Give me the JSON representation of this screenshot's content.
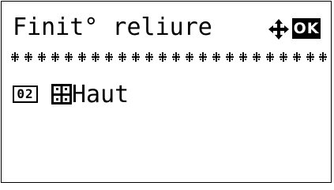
{
  "screen": {
    "title": "Finit° reliure",
    "nav_icon": "four-way-arrow-icon",
    "ok_label": "OK"
  },
  "selection": {
    "number": "02",
    "icon": "top-binding-icon",
    "label": "Haut"
  },
  "colors": {
    "foreground": "#000000",
    "background": "#ffffff"
  }
}
